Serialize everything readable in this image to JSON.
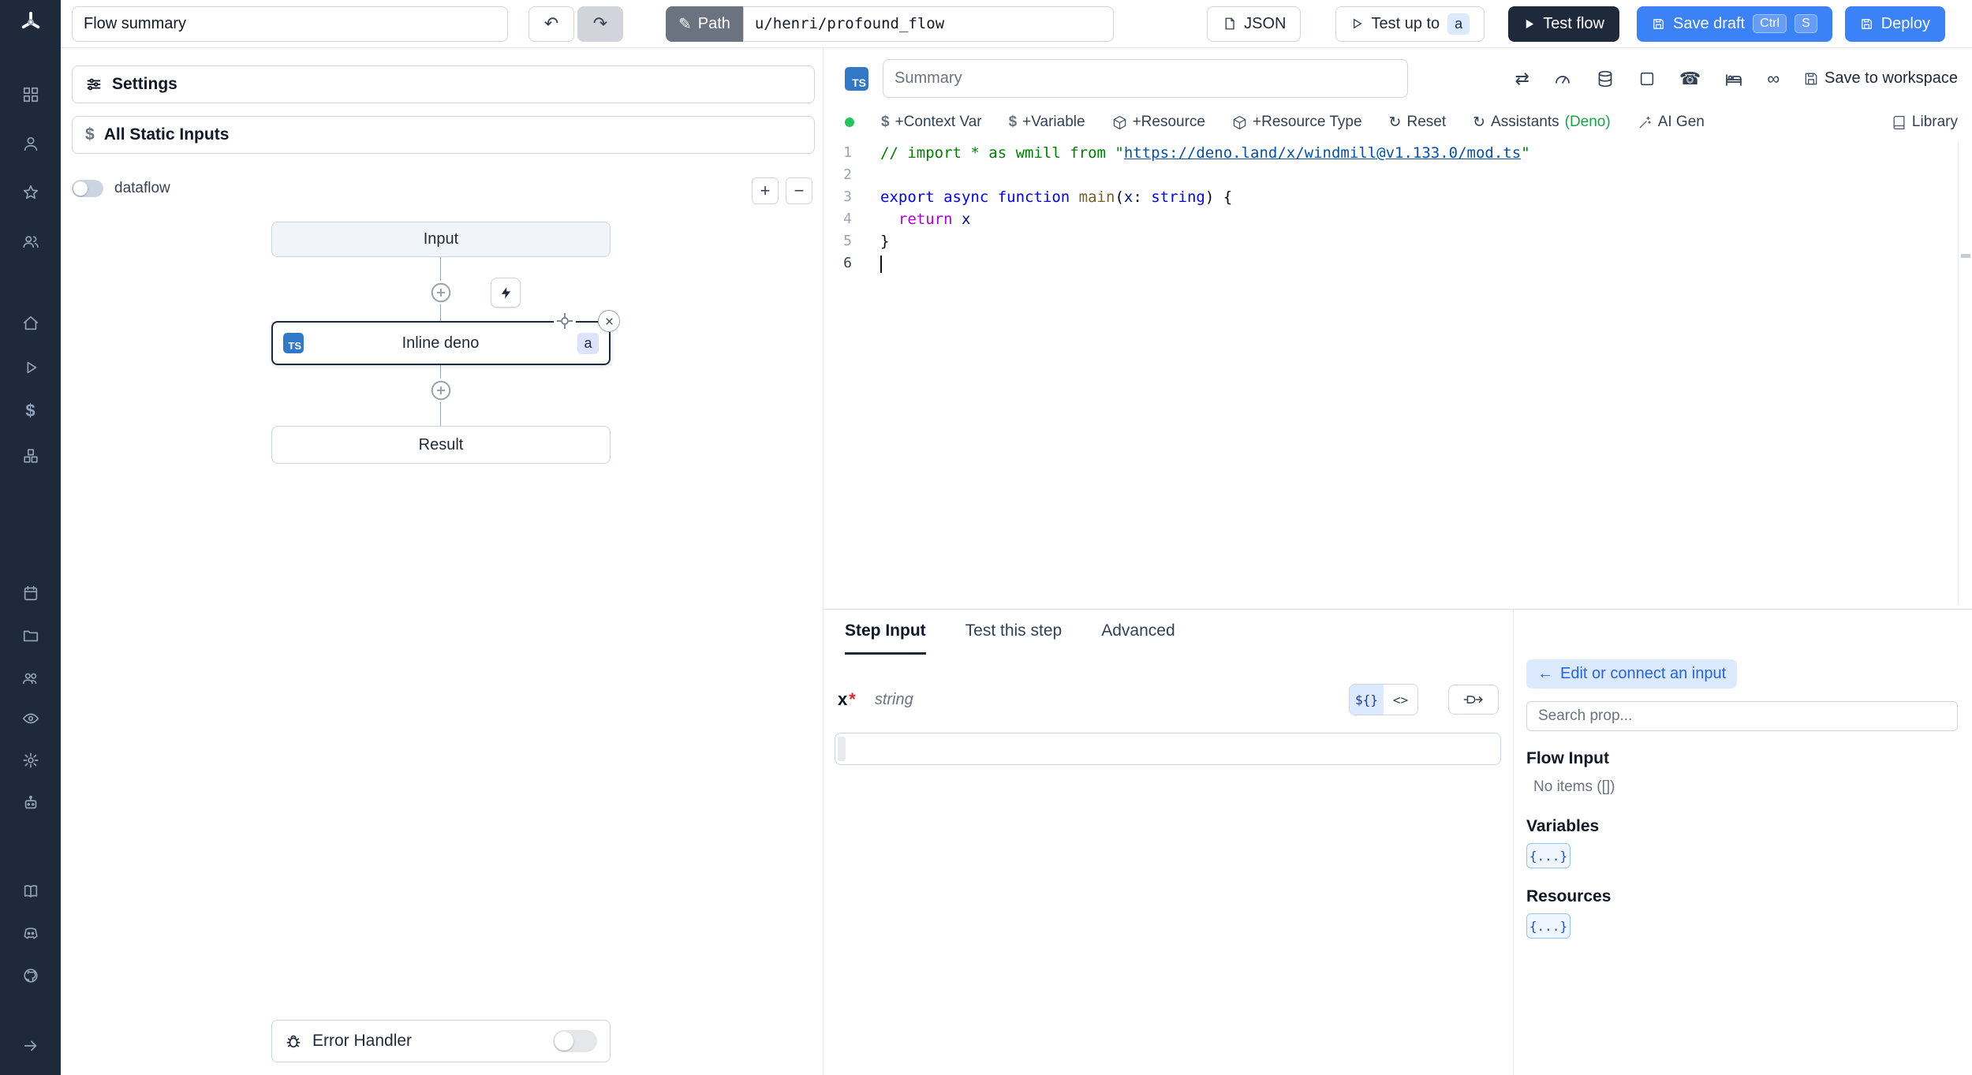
{
  "colors": {
    "accent_blue": "#3b82f6",
    "dark": "#1e293b",
    "assistants_green": "#16a34a",
    "required_red": "#dc2626",
    "badge_blue": "#dbeafe"
  },
  "sidebar": {
    "icon_names": [
      "windmill-logo",
      "apps-grid",
      "user",
      "star",
      "users",
      "home",
      "play",
      "dollar",
      "boxes",
      "calendar",
      "folder",
      "user-group",
      "eye",
      "gear",
      "robot",
      "book",
      "discord",
      "github",
      "arrow-right"
    ]
  },
  "topbar": {
    "flow_summary_value": "Flow summary",
    "undo_glyph": "↶",
    "redo_glyph": "↷",
    "path_label": "Path",
    "path_pencil": "✎",
    "path_value": "u/henri/profound_flow",
    "json_label": "JSON",
    "test_up_to_label": "Test up to",
    "test_up_to_badge": "a",
    "test_flow_label": "Test flow",
    "save_draft_label": "Save draft",
    "kbd_ctrl": "Ctrl",
    "kbd_s": "S",
    "deploy_label": "Deploy"
  },
  "flow_panel": {
    "settings_label": "Settings",
    "static_inputs_label": "All Static Inputs",
    "static_inputs_icon": "$",
    "dataflow_label": "dataflow",
    "zoom_in": "+",
    "zoom_out": "−",
    "input_node": "Input",
    "step_node_label": "Inline deno",
    "step_node_lang": "TS",
    "step_node_badge": "a",
    "result_node": "Result",
    "error_handler_label": "Error Handler"
  },
  "editor": {
    "lang_badge": "TS",
    "summary_placeholder": "Summary",
    "save_to_workspace_label": "Save to workspace",
    "toolbar": {
      "context_var_dollar": "$",
      "context_var": "+Context Var",
      "variable_dollar": "$",
      "variable": "+Variable",
      "resource": "+Resource",
      "resource_type": "+Resource Type",
      "reset_glyph": "↻",
      "reset": "Reset",
      "assistants_glyph": "↻",
      "assistants": "Assistants",
      "assistants_lang": "(Deno)",
      "ai_gen": "AI Gen",
      "library": "Library"
    },
    "header_icon_glyphs": {
      "cycle": "⇄",
      "phone": "☎",
      "infinity": "∞"
    },
    "code": {
      "cursor_line": 6,
      "lines": [
        [
          {
            "t": "// import * as wmill from \"",
            "c": "cmt"
          },
          {
            "t": "https://deno.land/x/windmill@v1.133.0/mod.ts",
            "c": "lnk"
          },
          {
            "t": "\"",
            "c": "cmt"
          }
        ],
        [],
        [
          {
            "t": "export async function ",
            "c": "kw"
          },
          {
            "t": "main",
            "c": "fn"
          },
          {
            "t": "(",
            "c": "pl"
          },
          {
            "t": "x",
            "c": "prm"
          },
          {
            "t": ": ",
            "c": "pl"
          },
          {
            "t": "string",
            "c": "kw"
          },
          {
            "t": ") {",
            "c": "pl"
          }
        ],
        [
          {
            "t": "  ",
            "c": "pl"
          },
          {
            "t": "return",
            "c": "ctrl"
          },
          {
            "t": " ",
            "c": "pl"
          },
          {
            "t": "x",
            "c": "prm"
          }
        ],
        [
          {
            "t": "}",
            "c": "pl"
          }
        ],
        []
      ]
    }
  },
  "step_panel": {
    "tabs": [
      "Step Input",
      "Test this step",
      "Advanced"
    ],
    "active_tab": "Step Input",
    "field_name": "x",
    "field_required": "*",
    "field_type": "string",
    "seg_template": "${}",
    "seg_code": "<>",
    "arg_value": ""
  },
  "prop_panel": {
    "edit_connect_arrow": "←",
    "edit_connect_label": "Edit or connect an input",
    "search_placeholder": "Search prop...",
    "flow_input_title": "Flow Input",
    "flow_input_empty": "No items ([])",
    "variables_title": "Variables",
    "variables_badge": "{...}",
    "resources_title": "Resources",
    "resources_badge": "{...}"
  }
}
